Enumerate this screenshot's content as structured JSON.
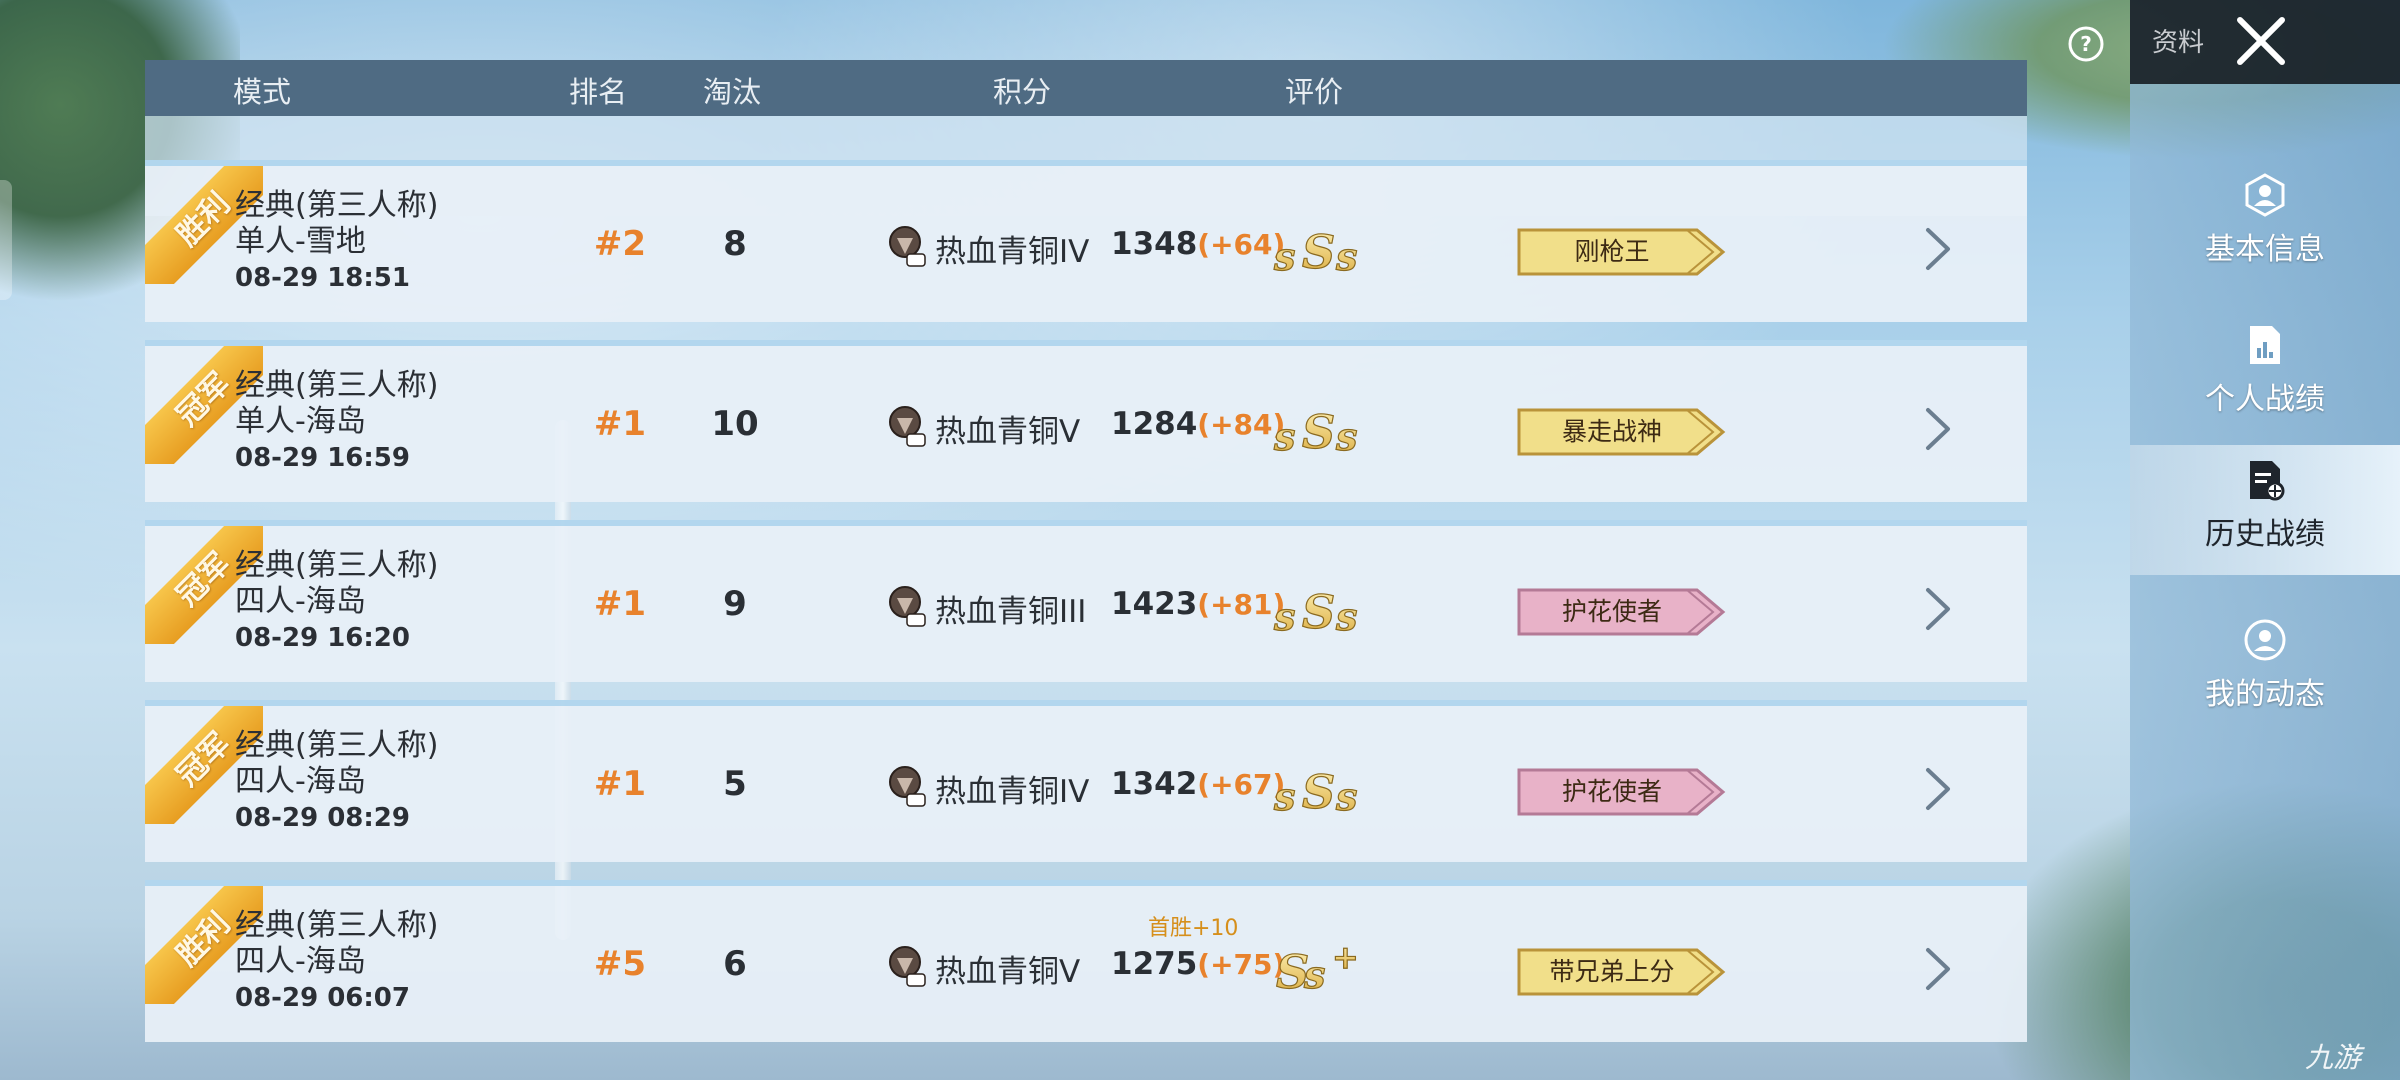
{
  "header": {
    "mode": "模式",
    "rank": "排名",
    "kills": "淘汰",
    "points": "积分",
    "rating": "评价"
  },
  "side": {
    "top_label": "资料",
    "nav": [
      {
        "label": "基本信息",
        "icon": "profile-icon"
      },
      {
        "label": "个人战绩",
        "icon": "stats-icon"
      },
      {
        "label": "历史战绩",
        "icon": "history-icon",
        "active": true
      },
      {
        "label": "我的动态",
        "icon": "activity-icon"
      }
    ]
  },
  "watermark": "九游",
  "matches": [
    {
      "result": "胜利",
      "mode": "经典(第三人称)",
      "map": "单人-雪地",
      "time": "08-29 18:51",
      "rank": "#2",
      "kills": "8",
      "tier": "热血青铜IV",
      "score": "1348",
      "delta": "(+64)",
      "bonus": "",
      "grade": "SSS",
      "title": "刚枪王",
      "title_style": "gold"
    },
    {
      "result": "冠军",
      "mode": "经典(第三人称)",
      "map": "单人-海岛",
      "time": "08-29 16:59",
      "rank": "#1",
      "kills": "10",
      "tier": "热血青铜V",
      "score": "1284",
      "delta": "(+84)",
      "bonus": "",
      "grade": "SSS",
      "title": "暴走战神",
      "title_style": "gold"
    },
    {
      "result": "冠军",
      "mode": "经典(第三人称)",
      "map": "四人-海岛",
      "time": "08-29 16:20",
      "rank": "#1",
      "kills": "9",
      "tier": "热血青铜III",
      "score": "1423",
      "delta": "(+81)",
      "bonus": "",
      "grade": "SSS",
      "title": "护花使者",
      "title_style": "pink"
    },
    {
      "result": "冠军",
      "mode": "经典(第三人称)",
      "map": "四人-海岛",
      "time": "08-29 08:29",
      "rank": "#1",
      "kills": "5",
      "tier": "热血青铜IV",
      "score": "1342",
      "delta": "(+67)",
      "bonus": "",
      "grade": "SSS",
      "title": "护花使者",
      "title_style": "pink"
    },
    {
      "result": "胜利",
      "mode": "经典(第三人称)",
      "map": "四人-海岛",
      "time": "08-29 06:07",
      "rank": "#5",
      "kills": "6",
      "tier": "热血青铜V",
      "score": "1275",
      "delta": "(+75)",
      "bonus": "首胜+10",
      "grade": "SS+",
      "title": "带兄弟上分",
      "title_style": "gold"
    }
  ],
  "colors": {
    "header_bg": "#4f6b83",
    "accent_orange": "#e8822c",
    "ribbon_gold": "#f2b53a",
    "badge_gold": "#f1df8a",
    "badge_pink": "#e8b2c8"
  }
}
